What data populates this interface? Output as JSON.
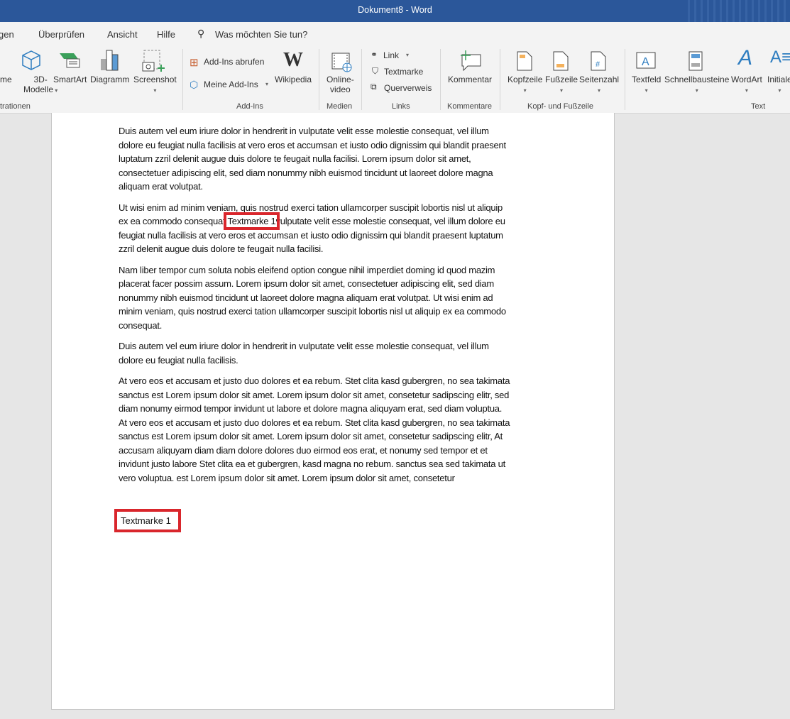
{
  "window": {
    "title": "Dokument8  -  Word"
  },
  "tabs": [
    "gen",
    "Überprüfen",
    "Ansicht",
    "Hilfe"
  ],
  "search": {
    "placeholder": "Was möchten Sie tun?"
  },
  "ribbon": {
    "illustrationen": {
      "items": [
        "me",
        "3D-",
        "Modelle",
        "SmartArt",
        "Diagramm",
        "Screenshot"
      ],
      "label": "trationen"
    },
    "addins": {
      "items": [
        "Add-Ins abrufen",
        "Meine Add-Ins",
        "Wikipedia"
      ],
      "label": "Add-Ins"
    },
    "medien": {
      "items": [
        "Online-",
        "video"
      ],
      "label": "Medien"
    },
    "links": {
      "items": [
        "Link",
        "Textmarke",
        "Querverweis"
      ],
      "label": "Links"
    },
    "kommentare": {
      "items": [
        "Kommentar"
      ],
      "label": "Kommentare"
    },
    "kopf": {
      "items": [
        "Kopfzeile",
        "Fußzeile",
        "Seitenzahl"
      ],
      "label": "Kopf- und Fußzeile"
    },
    "text": {
      "items": [
        "Textfeld",
        "Schnellbausteine",
        "WordArt",
        "Initiale"
      ],
      "label": "Text"
    }
  },
  "document": {
    "p1": [
      "Duis autem vel eum iriure dolor in hendrerit in vulputate velit esse molestie consequat, vel illum",
      "dolore eu feugiat nulla facilisis at vero eros et accumsan et iusto odio dignissim qui blandit praesent",
      "luptatum zzril delenit augue duis dolore te feugait nulla facilisi. Lorem ipsum dolor sit amet,",
      "consectetuer adipiscing elit, sed diam nonummy nibh euismod tincidunt ut laoreet dolore magna",
      "aliquam erat volutpat."
    ],
    "p2": {
      "line1": "Ut wisi enim ad minim veniam, quis nostrud exerci tation ullamcorper suscipit lobortis nisl ut aliquip",
      "line2_before": "ex ea commodo consequat ",
      "bookmark_field": "Textmarke 1",
      "line2_after": "vulputate velit esse molestie consequat, vel illum dolore eu",
      "rest": [
        "feugiat nulla facilisis at vero eros et accumsan et iusto odio dignissim qui blandit praesent luptatum",
        "zzril delenit augue duis dolore te feugait nulla facilisi."
      ]
    },
    "p3": [
      "Nam liber tempor cum soluta nobis eleifend option congue nihil imperdiet doming id quod mazim",
      "placerat facer possim assum. Lorem ipsum dolor sit amet, consectetuer adipiscing elit, sed diam",
      "nonummy nibh euismod tincidunt ut laoreet dolore magna aliquam erat volutpat. Ut wisi enim ad",
      "minim veniam, quis nostrud exerci tation ullamcorper suscipit lobortis nisl ut aliquip ex ea commodo",
      "consequat."
    ],
    "p4": [
      "Duis autem vel eum iriure dolor in hendrerit in vulputate velit esse molestie consequat, vel illum",
      "dolore eu feugiat nulla facilisis."
    ],
    "p5": [
      "At vero eos et accusam et justo duo dolores et ea rebum. Stet clita kasd gubergren, no sea takimata",
      "sanctus est Lorem ipsum dolor sit amet. Lorem ipsum dolor sit amet, consetetur sadipscing elitr, sed",
      "diam nonumy eirmod tempor invidunt ut labore et dolore magna aliquyam erat, sed diam voluptua.",
      "At vero eos et accusam et justo duo dolores et ea rebum. Stet clita kasd gubergren, no sea takimata",
      "sanctus est Lorem ipsum dolor sit amet. Lorem ipsum dolor sit amet, consetetur sadipscing elitr, At",
      "accusam aliquyam diam diam dolore dolores duo eirmod eos erat, et nonumy sed tempor et et",
      "invidunt justo labore Stet clita ea et gubergren, kasd magna no rebum. sanctus sea sed takimata ut",
      "vero voluptua. est Lorem ipsum dolor sit amet. Lorem ipsum dolor sit amet, consetetur"
    ],
    "bookmark": "Textmarke 1"
  },
  "colors": {
    "titlebar": "#2b579a",
    "highlight": "#d9262c"
  }
}
